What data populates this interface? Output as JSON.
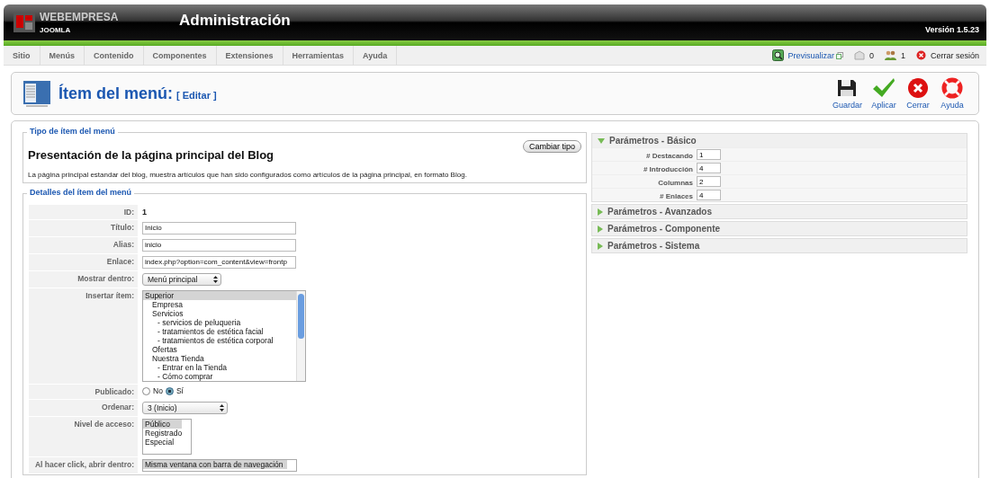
{
  "header": {
    "brand": "WEBEMPRESA",
    "brand_sub": "JOOMLA",
    "title": "Administración",
    "version": "Versión 1.5.23"
  },
  "menu": [
    {
      "label": "Sitio"
    },
    {
      "label": "Menús"
    },
    {
      "label": "Contenido"
    },
    {
      "label": "Componentes"
    },
    {
      "label": "Extensiones"
    },
    {
      "label": "Herramientas"
    },
    {
      "label": "Ayuda"
    }
  ],
  "status": {
    "preview": "Previsualizar",
    "messages": "0",
    "users": "1",
    "logout": "Cerrar sesión"
  },
  "page": {
    "title": "Ítem del menú:",
    "action": "[ Editar ]"
  },
  "toolbar": [
    {
      "kind": "save",
      "label": "Guardar"
    },
    {
      "kind": "apply",
      "label": "Aplicar"
    },
    {
      "kind": "close",
      "label": "Cerrar"
    },
    {
      "kind": "help",
      "label": "Ayuda"
    }
  ],
  "type_section": {
    "legend": "Tipo de ítem del menú",
    "title": "Presentación de la página principal del Blog",
    "button": "Cambiar tipo",
    "description": "La página principal estandar del blog, muestra artículos que han sido configurados como artículos de la página principal, en formato Blog."
  },
  "details": {
    "legend": "Detalles del ítem del menú",
    "rows": [
      {
        "kind": "text",
        "label": "ID:",
        "value": "1"
      },
      {
        "kind": "input",
        "label": "Título:",
        "value": "Inicio"
      },
      {
        "kind": "input",
        "label": "Alias:",
        "value": "inicio"
      },
      {
        "kind": "input",
        "label": "Enlace:",
        "value": "index.php?option=com_content&view=frontp"
      },
      {
        "kind": "select",
        "label": "Mostrar dentro:",
        "value": "Menú principal"
      },
      {
        "kind": "tree",
        "label": "Insertar ítem:",
        "items": [
          {
            "label": "Superior",
            "selected": true,
            "children": [
              {
                "label": "Empresa",
                "selected": false
              },
              {
                "label": "Servicios",
                "selected": false,
                "children": [
                  {
                    "label": "- servicios de peluqueria",
                    "selected": false
                  },
                  {
                    "label": "- tratamientos de estética facial",
                    "selected": false
                  },
                  {
                    "label": "- tratamientos de estética corporal",
                    "selected": false
                  }
                ]
              },
              {
                "label": "Ofertas",
                "selected": false
              },
              {
                "label": "Nuestra Tienda",
                "selected": false,
                "children": [
                  {
                    "label": "- Entrar en la Tienda",
                    "selected": false
                  },
                  {
                    "label": "- Cómo comprar",
                    "selected": false
                  }
                ]
              }
            ]
          }
        ]
      },
      {
        "kind": "radio",
        "label": "Publicado:",
        "options": [
          {
            "label": "No",
            "selected": false
          },
          {
            "label": "Sí",
            "selected": true
          }
        ]
      },
      {
        "kind": "select",
        "label": "Ordenar:",
        "value": "3 (Inicio)"
      },
      {
        "kind": "list",
        "label": "Nivel de acceso:",
        "items": [
          {
            "label": "Público",
            "selected": true
          },
          {
            "label": "Registrado",
            "selected": false
          },
          {
            "label": "Especial",
            "selected": false
          }
        ]
      },
      {
        "kind": "list",
        "label": "Al hacer click, abrir dentro:",
        "items": [
          {
            "label": "Misma ventana con barra de navegación",
            "selected": true
          }
        ]
      }
    ]
  },
  "params": [
    {
      "title": "Parámetros - Básico",
      "expanded": true,
      "rows": [
        {
          "label": "# Destacando",
          "value": "1"
        },
        {
          "label": "# Introducción",
          "value": "4"
        },
        {
          "label": "Columnas",
          "value": "2"
        },
        {
          "label": "# Enlaces",
          "value": "4"
        }
      ]
    },
    {
      "title": "Parámetros - Avanzados",
      "expanded": false
    },
    {
      "title": "Parámetros - Componente",
      "expanded": false
    },
    {
      "title": "Parámetros - Sistema",
      "expanded": false
    }
  ]
}
